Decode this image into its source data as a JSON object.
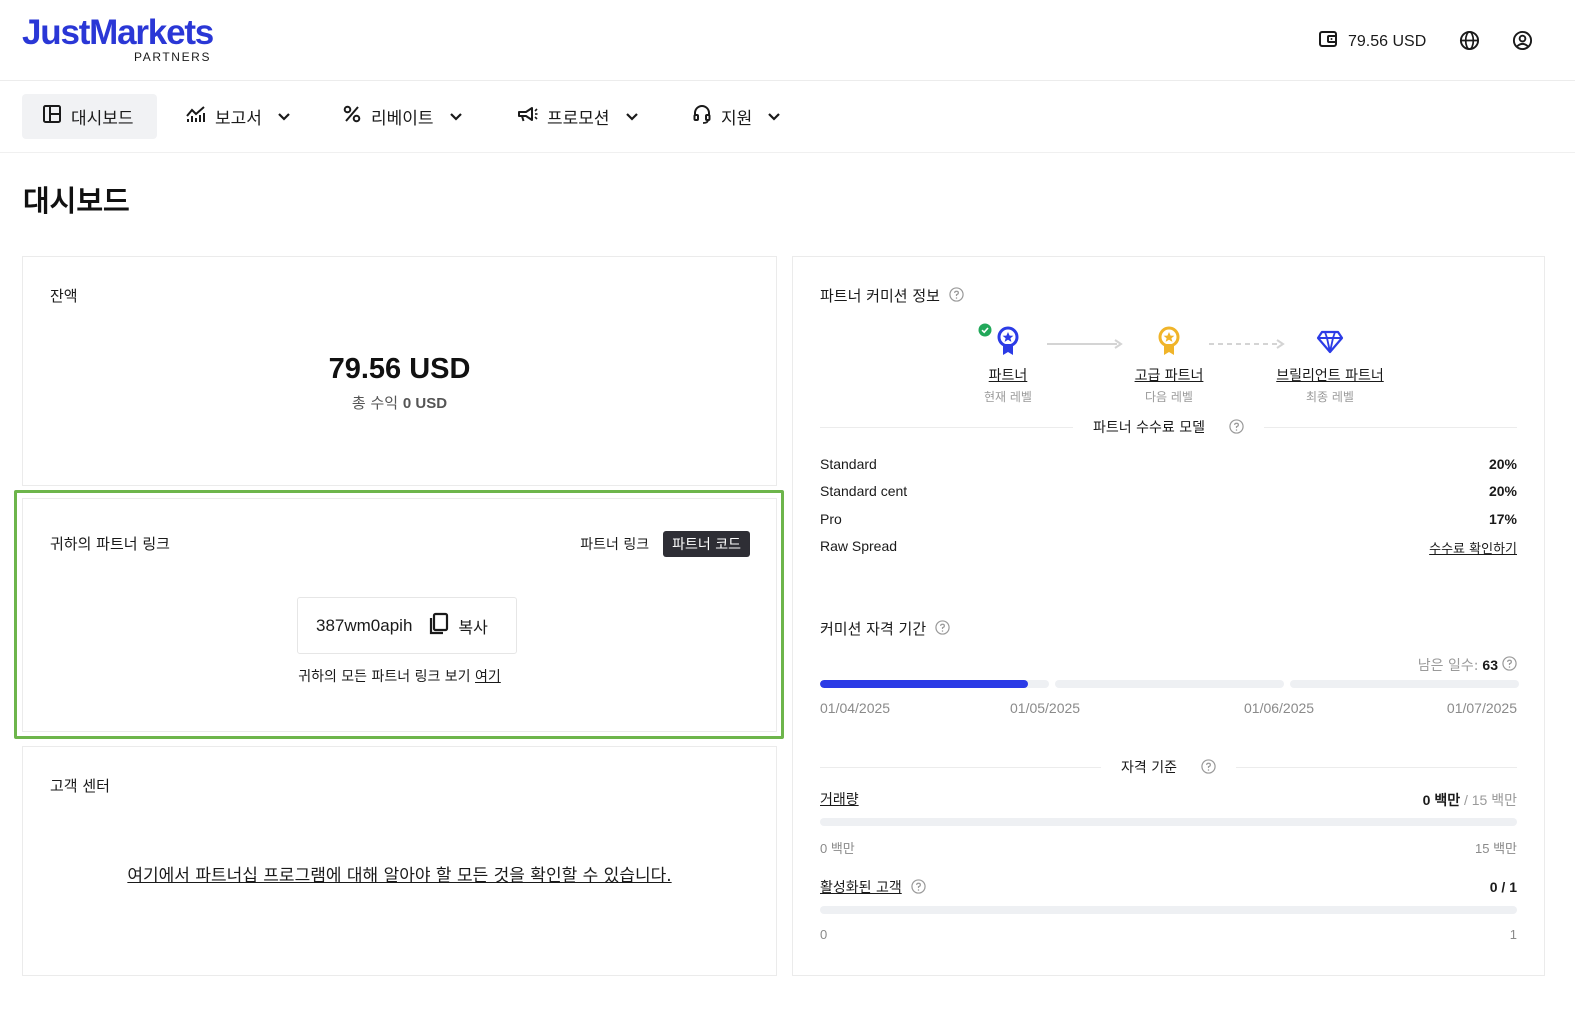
{
  "header": {
    "logo_main": "JustMarkets",
    "logo_sub": "PARTNERS",
    "wallet_balance": "79.56 USD",
    "icons": [
      "wallet-icon",
      "globe-icon",
      "user-icon"
    ]
  },
  "nav": {
    "items": [
      {
        "label": "대시보드",
        "icon": "dashboard-icon",
        "active": true
      },
      {
        "label": "보고서",
        "icon": "chart-icon"
      },
      {
        "label": "리베이트",
        "icon": "percent-icon"
      },
      {
        "label": "프로모션",
        "icon": "megaphone-icon"
      },
      {
        "label": "지원",
        "icon": "headset-icon"
      }
    ]
  },
  "page": {
    "title": "대시보드"
  },
  "balance": {
    "title": "잔액",
    "amount": "79.56 USD",
    "total_label": "총 수익",
    "total_value": "0 USD"
  },
  "partner_link": {
    "title": "귀하의 파트너 링크",
    "toggle_link": "파트너 링크",
    "toggle_code": "파트너 코드",
    "code": "387wm0apih",
    "copy_label": "복사",
    "view_all_text": "귀하의 모든 파트너 링크 보기",
    "view_all_link": "여기"
  },
  "client_center": {
    "title": "고객 센터",
    "link": "여기에서 파트너십 프로그램에 대해 알아야 할 모든 것을 확인할 수 있습니다."
  },
  "commission": {
    "title": "파트너 커미션 정보",
    "levels": [
      {
        "name": "파트너",
        "sub": "현재 레벨",
        "color": "#2b3be6"
      },
      {
        "name": "고급 파트너",
        "sub": "다음 레벨",
        "color": "#f0b429"
      },
      {
        "name": "브릴리언트 파트너",
        "sub": "최종 레벨",
        "color": "#2b3be6"
      }
    ],
    "model_title": "파트너 수수료 모델",
    "rows": [
      {
        "name": "Standard",
        "value": "20%"
      },
      {
        "name": "Standard cent",
        "value": "20%"
      },
      {
        "name": "Pro",
        "value": "17%"
      },
      {
        "name": "Raw Spread",
        "value": "수수료 확인하기"
      }
    ]
  },
  "eligibility": {
    "title": "커미션 자격 기간",
    "remaining_label": "남은 일수:",
    "remaining_value": "63",
    "progress": 0.91,
    "dates": [
      "01/04/2025",
      "01/05/2025",
      "01/06/2025",
      "01/07/2025"
    ],
    "criteria_title": "자격 기준",
    "volume": {
      "label": "거래량",
      "current": "0 백만",
      "target": "/ 15 백만",
      "min": "0 백만",
      "max": "15 백만",
      "progress": 0
    },
    "active_clients": {
      "label": "활성화된 고객",
      "current": "0 / 1",
      "min": "0",
      "max": "1",
      "progress": 0
    }
  },
  "colors": {
    "brand": "#2a37d6",
    "highlight": "#6db54b",
    "accent": "#2b3be6",
    "gold": "#f0b429"
  }
}
